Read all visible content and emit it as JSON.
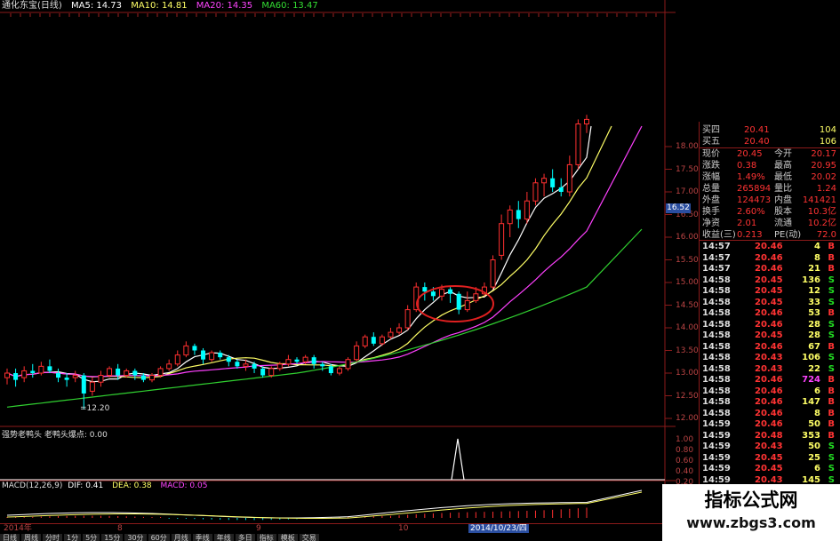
{
  "header": {
    "title": "通化东宝(日线)",
    "ma5": "MA5: 14.73",
    "ma10": "MA10: 14.81",
    "ma20": "MA20: 14.35",
    "ma60": "MA60: 13.47"
  },
  "price_axis": [
    "18.00",
    "17.50",
    "17.00",
    "16.50",
    "16.00",
    "15.50",
    "15.00",
    "14.50",
    "14.00",
    "13.50",
    "13.00",
    "12.50",
    "12.00"
  ],
  "current_price_tag": "16.52",
  "low_annotation": "=12.20",
  "indicator": {
    "label": "强势老鸭头 老鸭头爆点: 0.00",
    "axis": [
      "1.00",
      "0.80",
      "0.60",
      "0.40",
      "0.20"
    ]
  },
  "macd": {
    "name": "MACD(12,26,9)",
    "dif": "DIF: 0.41",
    "dea": "DEA: 0.38",
    "macd": "MACD: 0.05"
  },
  "date_axis": {
    "year": "2014年",
    "months": [
      "8",
      "9",
      "10"
    ],
    "cursor_date": "2014/10/23/四"
  },
  "quote": {
    "buy4": {
      "label": "买四",
      "price": "20.41",
      "vol": "104"
    },
    "buy5": {
      "label": "买五",
      "price": "20.40",
      "vol": "106"
    },
    "rows": [
      {
        "l1": "现价",
        "v1": "20.45",
        "l2": "今开",
        "v2": "20.17"
      },
      {
        "l1": "涨跌",
        "v1": "0.38",
        "l2": "最高",
        "v2": "20.95"
      },
      {
        "l1": "涨幅",
        "v1": "1.49%",
        "l2": "最低",
        "v2": "20.02"
      },
      {
        "l1": "总量",
        "v1": "265894",
        "l2": "量比",
        "v2": "1.24"
      },
      {
        "l1": "外盘",
        "v1": "124473",
        "l2": "内盘",
        "v2": "141421"
      },
      {
        "l1": "换手",
        "v1": "2.60%",
        "l2": "股本",
        "v2": "10.3亿"
      },
      {
        "l1": "净资",
        "v1": "2.01",
        "l2": "流通",
        "v2": "10.2亿"
      },
      {
        "l1": "收益(三)",
        "v1": "0.213",
        "l2": "PE(动)",
        "v2": "72.0"
      }
    ]
  },
  "ticks": [
    {
      "t": "14:57",
      "p": "20.46",
      "v": "4",
      "s": "B"
    },
    {
      "t": "14:57",
      "p": "20.46",
      "v": "8",
      "s": "B"
    },
    {
      "t": "14:57",
      "p": "20.46",
      "v": "21",
      "s": "B"
    },
    {
      "t": "14:58",
      "p": "20.45",
      "v": "136",
      "s": "S"
    },
    {
      "t": "14:58",
      "p": "20.45",
      "v": "12",
      "s": "S"
    },
    {
      "t": "14:58",
      "p": "20.45",
      "v": "33",
      "s": "S"
    },
    {
      "t": "14:58",
      "p": "20.46",
      "v": "53",
      "s": "B"
    },
    {
      "t": "14:58",
      "p": "20.46",
      "v": "28",
      "s": "S"
    },
    {
      "t": "14:58",
      "p": "20.45",
      "v": "28",
      "s": "S"
    },
    {
      "t": "14:58",
      "p": "20.46",
      "v": "67",
      "s": "B"
    },
    {
      "t": "14:58",
      "p": "20.43",
      "v": "106",
      "s": "S"
    },
    {
      "t": "14:58",
      "p": "20.43",
      "v": "22",
      "s": "S"
    },
    {
      "t": "14:58",
      "p": "20.46",
      "v": "724",
      "s": "B"
    },
    {
      "t": "14:58",
      "p": "20.46",
      "v": "6",
      "s": "B"
    },
    {
      "t": "14:58",
      "p": "20.46",
      "v": "147",
      "s": "B"
    },
    {
      "t": "14:58",
      "p": "20.46",
      "v": "8",
      "s": "B"
    },
    {
      "t": "14:59",
      "p": "20.46",
      "v": "50",
      "s": "B"
    },
    {
      "t": "14:59",
      "p": "20.48",
      "v": "353",
      "s": "B"
    },
    {
      "t": "14:59",
      "p": "20.43",
      "v": "50",
      "s": "S"
    },
    {
      "t": "14:59",
      "p": "20.45",
      "v": "25",
      "s": "S"
    },
    {
      "t": "14:59",
      "p": "20.45",
      "v": "6",
      "s": "S"
    },
    {
      "t": "14:59",
      "p": "20.43",
      "v": "145",
      "s": "S"
    }
  ],
  "watermark": {
    "line1": "指标公式网",
    "line2": "www.zbgs3.com"
  },
  "tabs": [
    "日线",
    "周线",
    "分时",
    "1分",
    "5分",
    "15分",
    "30分",
    "60分",
    "月线",
    "季线",
    "年线",
    "多日",
    "指标",
    "模板",
    "交易"
  ],
  "colors": {
    "up": "#ff3030",
    "down": "#00ffff",
    "ma5": "#ffffff",
    "ma10": "#ffff66",
    "ma20": "#ff40ff",
    "ma60": "#30d030"
  }
}
